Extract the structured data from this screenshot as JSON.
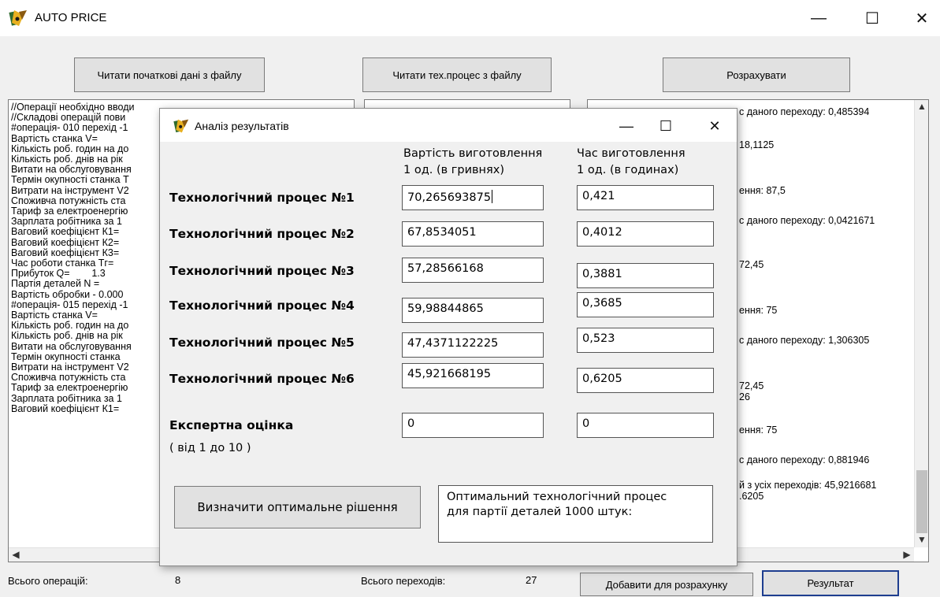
{
  "window": {
    "title": "AUTO PRICE",
    "minimize": "—",
    "maximize": "☐",
    "close": "✕"
  },
  "toolbar": {
    "read_initial": "Читати початкові дані з файлу",
    "read_process": "Читати тех.процес з файлу",
    "calculate": "Розрахувати"
  },
  "left_text": [
    "//Операції необхідно вводи",
    "//Складові операцій пови",
    "#операція- 010 перехід -1",
    "Вартість станка V=",
    "Кількість роб. годин на до",
    "Кількість роб. днів на рік",
    "Витати на обслуговування",
    "Термін окупності станка Т",
    "Витрати на інструмент V2",
    "Споживча потужність ста",
    "Тариф за електроенергію",
    "Зарплата робітника за 1",
    "Ваговий коефіцієнт К1=",
    "Ваговий коефіцієнт К2=",
    "Ваговий коефіцієнт К3=",
    "Час роботи станка Тг=",
    "Прибуток Q=        1.3",
    "Партія деталей N =",
    "Вартість обробки - 0.000",
    "#операція- 015 перехід -1",
    "Вартість станка V=",
    "Кількість роб. годин на до",
    "Кількість роб. днів на рік",
    "Витати на обслуговування",
    "Термін окупності станка",
    "Витрати на інструмент V2",
    "Споживча потужність ста",
    "Тариф за електроенергію",
    "Зарплата робітника за 1",
    "Ваговий коефіцієнт К1="
  ],
  "right_text": [
    "с даного переходу: 0,485394",
    "18,1125",
    "ення: 87,5",
    "с даного переходу: 0,0421671",
    "72,45",
    "ення: 75",
    "с даного переходу: 1,306305",
    "72,45",
    "26",
    "ення: 75",
    "с даного переходу: 0,881946",
    "й з усіх переходів: 45,9216681",
    ".6205"
  ],
  "status": {
    "operations_label": "Всього операцій:",
    "operations_value": "8",
    "transitions_label": "Всього переходів:",
    "transitions_value": "27",
    "add_button": "Добавити для розрахунку",
    "result_button": "Результат"
  },
  "dialog": {
    "title": "Аналіз результатів",
    "minimize": "—",
    "maximize": "☐",
    "close": "✕",
    "col_cost_line1": "Вартість виготовлення",
    "col_cost_line2": "1 од. (в гривнях)",
    "col_time_line1": "Час виготовлення",
    "col_time_line2": "1 од. (в годинах)",
    "rows": [
      {
        "label": "Технологічний процес №1",
        "cost": "70,265693875",
        "time": "0,421"
      },
      {
        "label": "Технологічний процес №2",
        "cost": "67,8534051",
        "time": "0,4012"
      },
      {
        "label": "Технологічний процес №3",
        "cost": "57,28566168",
        "time": "0,3881"
      },
      {
        "label": "Технологічний процес №4",
        "cost": "59,98844865",
        "time": "0,3685"
      },
      {
        "label": "Технологічний процес №5",
        "cost": "47,4371122225",
        "time": "0,523"
      },
      {
        "label": "Технологічний процес №6",
        "cost": "45,921668195",
        "time": "0,6205"
      }
    ],
    "expert_label": "Експертна оцінка",
    "expert_range": "( від 1 до 10 )",
    "expert_cost": "0",
    "expert_time": "0",
    "find_button": "Визначити оптимальне рішення",
    "result_line1": "Оптимальний технологічний процес",
    "result_line2": "для партії деталей 1000 штук:"
  }
}
